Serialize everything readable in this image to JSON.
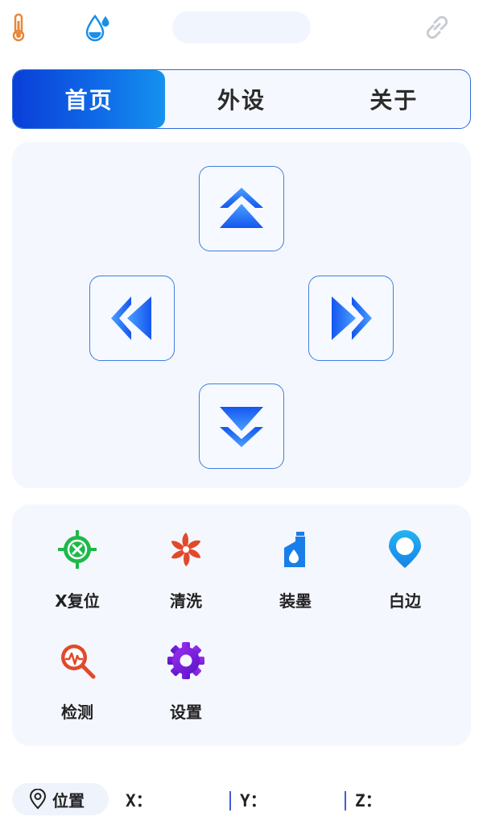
{
  "status": {
    "temperature_icon": "thermometer-icon",
    "humidity_icon": "water-drop-icon",
    "link_icon": "link-icon",
    "colors": {
      "temperature": "#e8883a",
      "humidity": "#1a8fe8",
      "link": "#c9ccd3"
    }
  },
  "tabs": [
    {
      "label": "首页",
      "active": true
    },
    {
      "label": "外设",
      "active": false
    },
    {
      "label": "关于",
      "active": false
    }
  ],
  "direction_pad": {
    "buttons": [
      "up",
      "left",
      "right",
      "down"
    ],
    "accent": "#1e6cf0"
  },
  "functions": [
    {
      "label": "X复位",
      "icon": "x-reset-icon",
      "color": "#1fb84a"
    },
    {
      "label": "清洗",
      "icon": "pinwheel-icon",
      "color": "#e2492b"
    },
    {
      "label": "装墨",
      "icon": "ink-bottle-icon",
      "color": "#1a7ee8"
    },
    {
      "label": "白边",
      "icon": "location-pin-icon",
      "color": "#1aa0e8"
    },
    {
      "label": "检测",
      "icon": "magnifier-pulse-icon",
      "color": "#e2492b"
    },
    {
      "label": "设置",
      "icon": "gear-icon",
      "color": "#7a1fd8"
    }
  ],
  "position": {
    "label": "位置",
    "x_label": "X：",
    "y_label": "Y：",
    "z_label": "Z："
  }
}
